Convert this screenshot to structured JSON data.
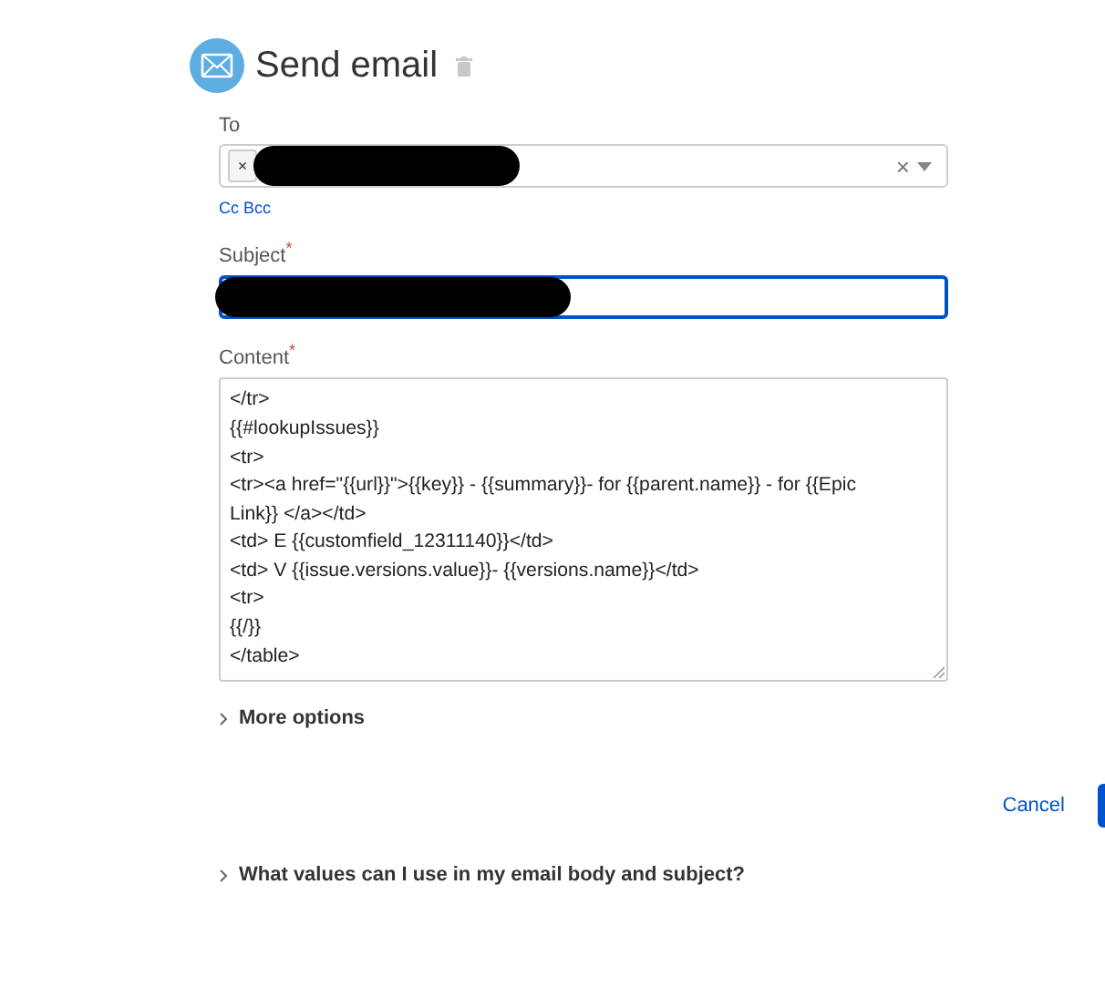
{
  "action": {
    "title": "Send email"
  },
  "to": {
    "label": "To",
    "recipients": [
      {
        "remove": "×",
        "redacted": true
      }
    ],
    "clear": "×",
    "cc_bcc": "Cc Bcc"
  },
  "subject": {
    "label": "Subject",
    "required": "*",
    "redacted": true,
    "focused": true
  },
  "content": {
    "label": "Content",
    "required": "*",
    "value": "</tr>\n{{#lookupIssues}}\n<tr>\n<tr><a href=\"{{url}}\">{{key}} - {{summary}}- for {{parent.name}} - for {{Epic Link}} </a></td>\n<td> E {{customfield_12311140}}</td>\n<td> V {{issue.versions.value}}- {{versions.name}}</td>\n<tr>\n{{/}}\n</table>"
  },
  "more_options": {
    "label": "More options",
    "expanded": false
  },
  "buttons": [
    {
      "label": "Cancel"
    }
  ],
  "help": {
    "label": "What values can I use in my email body and subject?",
    "expanded": false
  }
}
